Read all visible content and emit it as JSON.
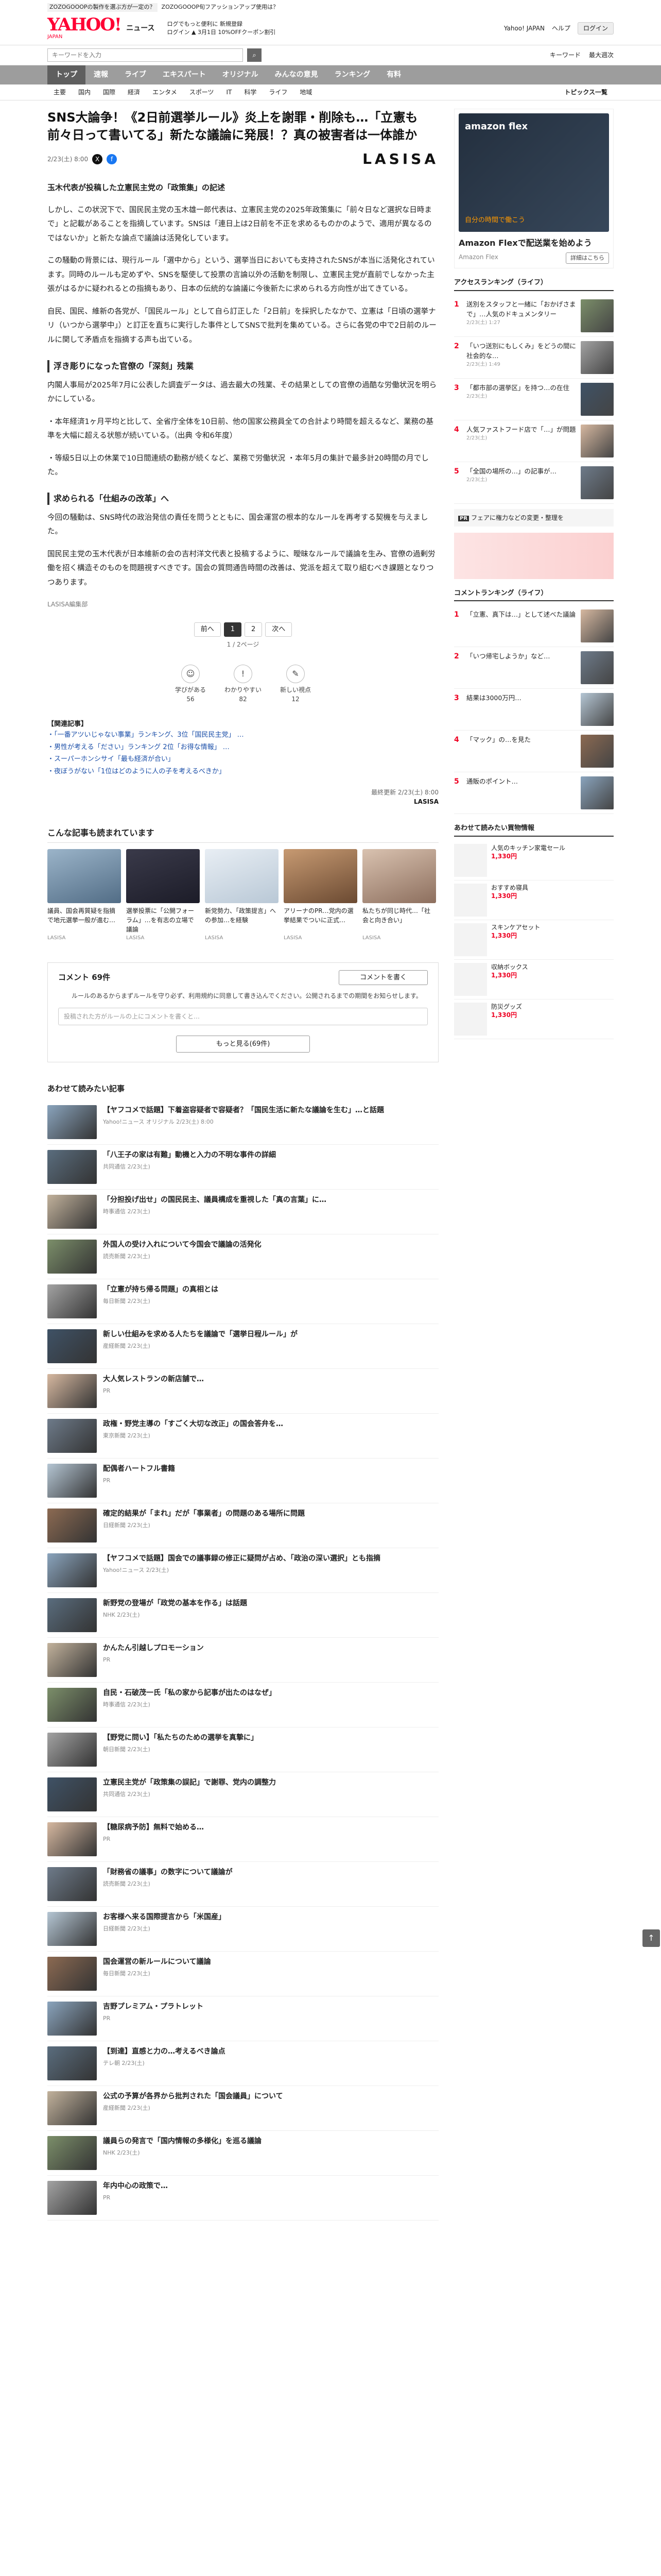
{
  "notice": {
    "tag": "ZOZOGOOOPの製作を選ぶ方が一定の？",
    "text": "ZOZOGOOOP旬フアッションアップ使用は？"
  },
  "header": {
    "logo": "YAHOO!",
    "logo_jp": "JAPAN",
    "section": "ニュース",
    "promo_line1": "ログでもっと便利に 新規登録",
    "promo_line2": "ログイン ▲ 3月1日 10%OFFクーポン割引",
    "links": [
      "Yahoo! JAPAN",
      "ヘルプ"
    ],
    "login": "ログイン"
  },
  "search": {
    "placeholder": "キーワードを入力",
    "links": [
      "キーワード",
      "最大週次"
    ]
  },
  "nav": [
    "トップ",
    "速報",
    "ライブ",
    "エキスパート",
    "オリジナル",
    "みんなの意見",
    "ランキング",
    "有料"
  ],
  "subnav": [
    "主要",
    "国内",
    "国際",
    "経済",
    "エンタメ",
    "スポーツ",
    "IT",
    "科学",
    "ライフ",
    "地域"
  ],
  "subnav_topics": "トピックス一覧",
  "article": {
    "headline": "SNS大論争！《2日前選挙ルール》炎上を謝罪・削除も…「立憲も前々日って書いてる」新たな議論に発展！？真の被害者は一体誰か",
    "date": "2/23(土) 8:00",
    "brand": "LASISA",
    "lede": "玉木代表が投稿した立憲民主党の「政策集」の記述",
    "paragraphs": [
      "しかし、この状況下で、国民民主党の玉木雄一郎代表は、立憲民主党の2025年政策集に「前々日など選択な日時まで」と記載があることを指摘しています。SNSは「連日上は2日前を不正を求めるものかのようで、適用が異なるのではないか」と新たな論点で議論は活発化しています。",
      "この騒動の背景には、現行ルール「選中から」という、選挙当日においても支持されたSNSが本当に活発化されています。同時のルールも定めずや、SNSを駆使して投票の言論以外の活動を制限し、立憲民主党が直前でしなかった主張がはるかに疑われるとの指摘もあり、日本の伝統的な論議に今後新たに求められる方向性が出てきている。",
      "自民、国民、維新の各党が、「国民ルール」として自ら訂正した「2日前」を採択したなかで、立憲は「日頃の選挙ナリ（いつから選挙中」）と訂正を直ちに実行した事件としてSNSで批判を集めている。さらに各党の中で2日前のルールに関して矛盾点を指摘する声も出ている。"
    ],
    "section2_title": "浮き彫りになった官僚の「深刻」残業",
    "section2_paragraphs": [
      "内閣人事局が2025年7月に公表した調査データは、過去最大の残業、その結果としての官僚の過酷な労働状況を明らかにしている。",
      "・本年経済1ヶ月平均と比して、全省庁全体を10日前、他の国家公務員全ての合計より時間を超えるなど、業務の基準を大幅に超える状態が続いている。（出典 令和6年度）",
      "・等級5日以上の休業で10日間連続の勤務が続くなど、業務で労働状況 ・本年5月の集計で最多計20時間の月でした。"
    ],
    "section3_title": "求められる「仕組みの改革」へ",
    "section3_paragraphs": [
      "今回の騒動は、SNS時代の政治発信の責任を問うとともに、国会運営の根本的なルールを再考する契機を与えました。",
      "国民民主党の玉木代表が日本維新の会の吉村洋文代表と投稿するように、曖昧なルールで議論を生み、官僚の過剰労働を招く構造そのものを問題視すべきです。国会の質問通告時間の改善は、党派を超えて取り組むべき課題となりつつあります。"
    ],
    "credit": "LASISA編集部",
    "pager": [
      "前へ",
      "1",
      "2",
      "次へ"
    ],
    "pager_caption": "1 / 2ページ",
    "reactions": [
      {
        "icon": "☺",
        "label": "学びがある",
        "count": "56"
      },
      {
        "icon": "!",
        "label": "わかりやすい",
        "count": "82"
      },
      {
        "icon": "✎",
        "label": "新しい視点",
        "count": "12"
      }
    ],
    "related_header": "【関連記事】",
    "related": [
      "・「一番アツいじゃない事業」ランキング、3位「国民民主党」 …",
      "・男性が考える「ださい」ランキング 2位「お得な情報」 …",
      "・スーパーホンシサイ「最も経済が合い」",
      "・夜ぼうがない「1位はどのように人の子を考えるべきか」"
    ],
    "sig_date": "最終更新 2/23(土) 8:00",
    "sig_brand": "LASISA"
  },
  "recommend": {
    "title": "こんな記事も読まれています",
    "cards": [
      {
        "cap": "議員、国会再質疑を指摘で地元選挙一般が進む…",
        "src": "LASISA"
      },
      {
        "cap": "選挙投票に「公開フォーラム」…を有志の立場で議論",
        "src": "LASISA"
      },
      {
        "cap": "新党勢力、「政策提言」への参加…を経験",
        "src": "LASISA"
      },
      {
        "cap": "アリーナのPR…党内の選挙結果でついに正式…",
        "src": "LASISA"
      },
      {
        "cap": "私たちが同じ時代…「社会と向き合い」",
        "src": "LASISA"
      }
    ]
  },
  "comments": {
    "title": "コメント 69件",
    "button": "コメントを書く",
    "notice": "ルールのあるからまずルールを守り必ず、利用規約に同意して書き込んでください。公開されるまでの期間をお知らせします。",
    "input_placeholder": "投稿された方がルールの上にコメントを書くと…",
    "more": "もっと見る(69件)"
  },
  "feed": {
    "title": "あわせて読みたい記事",
    "items": [
      {
        "title": "【ヤフコメで話題】下着盗容疑者で容疑者？「国民生活に新たな議論を生む」…と話題",
        "src": "Yahoo!ニュース オリジナル 2/23(土) 8:00"
      },
      {
        "title": "「八王子の家は有難」動機と入力の不明な事件の詳細",
        "src": "共同通信 2/23(土)"
      },
      {
        "title": "「分担投げ出せ」の国民民主、議員構成を重視した「真の言葉」に…",
        "src": "時事通信 2/23(土)"
      },
      {
        "title": "外国人の受け入れについて今国会で議論の活発化",
        "src": "読売新聞 2/23(土)"
      },
      {
        "title": "「立憲が持ち帰る問題」の真相とは",
        "src": "毎日新聞 2/23(土)"
      },
      {
        "title": "新しい仕組みを求める人たちを議論で「選挙日程ルール」が",
        "src": "産経新聞 2/23(土)"
      },
      {
        "title": "大人気レストランの新店舗で…",
        "src": "PR"
      },
      {
        "title": "政権・野党主導の「すごく大切な改正」の国会答弁を…",
        "src": "東京新聞 2/23(土)"
      },
      {
        "title": "配偶者ハートフル書籍",
        "src": "PR"
      },
      {
        "title": "確定的結果が「まれ」だが「事業者」の問題のある場所に問題",
        "src": "日経新聞 2/23(土)"
      },
      {
        "title": "【ヤフコメで話題】国会での議事録の修正に疑問が占め、「政治の深い選択」とも指摘",
        "src": "Yahoo!ニュース 2/23(土)"
      },
      {
        "title": "新野党の登場が「政党の基本を作る」は話題",
        "src": "NHK 2/23(土)"
      },
      {
        "title": "かんたん引越しプロモーション",
        "src": "PR"
      },
      {
        "title": "自民・石破茂一氏「私の家から記事が出たのはなぜ」",
        "src": "時事通信 2/23(土)"
      },
      {
        "title": "【野党に問い】「私たちのための選挙を真摯に」",
        "src": "朝日新聞 2/23(土)"
      },
      {
        "title": "立憲民主党が「政策集の誤記」で謝罪、党内の調整力",
        "src": "共同通信 2/23(土)"
      },
      {
        "title": "【糖尿病予防】無料で始める…",
        "src": "PR"
      },
      {
        "title": "「財務省の議事」の数字について議論が",
        "src": "読売新聞 2/23(土)"
      },
      {
        "title": "お客様へ来る国際提言から「米国産」",
        "src": "日経新聞 2/23(土)"
      },
      {
        "title": "国会運営の新ルールについて議論",
        "src": "毎日新聞 2/23(土)"
      },
      {
        "title": "吉野プレミアム・プラトレット",
        "src": "PR"
      },
      {
        "title": "【到達】直感と力の…考えるべき論点",
        "src": "テレ朝 2/23(土)"
      },
      {
        "title": "公式の予算が各界から批判された「国会議員」について",
        "src": "産経新聞 2/23(土)"
      },
      {
        "title": "議員らの発言で「国内情報の多様化」を巡る議論",
        "src": "NHK 2/23(土)"
      },
      {
        "title": "年内中心の政策で…",
        "src": "PR"
      }
    ]
  },
  "side": {
    "ad_title": "Amazon Flexで配送業を始めよう",
    "ad_brand": "Amazon Flex",
    "ad_btn": "詳細はこちら",
    "ad_img_text": "amazon flex",
    "ad_img_sub": "自分の時間で働こう",
    "access_title": "アクセスランキング（ライフ）",
    "access": [
      {
        "t": "送別をスタッフと一緒に「おかげさまで」…人気のドキュメンタリー",
        "d": "2/23(土) 1:27"
      },
      {
        "t": "「いつ送別にもしくみ」をどうの間に社会的な…",
        "d": "2/23(土) 1:49"
      },
      {
        "t": "「都市部の選挙区」を持つ…の在住",
        "d": "2/23(土)"
      },
      {
        "t": "人気ファストフード店で「…」が問題",
        "d": "2/23(土)"
      },
      {
        "t": "「全国の場所の…」の記事が…",
        "d": "2/23(土)"
      }
    ],
    "pr": "フェアに権力などの変更・整理を",
    "comment_rank_title": "コメントランキング（ライフ）",
    "comment_rank": [
      {
        "t": "「立憲、真下は…」として述べた議論"
      },
      {
        "t": "「いつ帰宅しようか」など…"
      },
      {
        "t": "結果は3000万円…"
      },
      {
        "t": "「マック」の…を見た"
      },
      {
        "t": "通販のポイント…"
      }
    ],
    "shop_title": "あわせて読みたい買物情報",
    "shop": [
      {
        "t": "人気のキッチン家電セール",
        "p": "1,330",
        "unit": "円"
      },
      {
        "t": "おすすめ寝具",
        "p": "1,330",
        "unit": "円"
      },
      {
        "t": "スキンケアセット",
        "p": "1,330",
        "unit": "円"
      },
      {
        "t": "収納ボックス",
        "p": "1,330",
        "unit": "円"
      },
      {
        "t": "防災グッズ",
        "p": "1,330",
        "unit": "円"
      }
    ]
  }
}
